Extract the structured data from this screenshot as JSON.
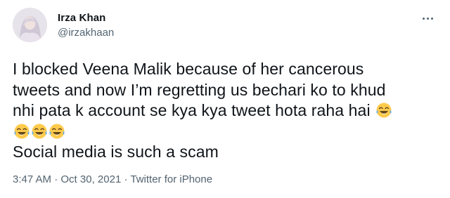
{
  "author": {
    "name": "Irza Khan",
    "handle": "@irzakhaan"
  },
  "tweet": {
    "lines": [
      "I blocked Veena Malik because of her cancerous",
      "tweets and now I’m regretting us bechari ko to khud",
      "nhi pata k account se kya kya tweet hota raha hai"
    ],
    "last_line": "Social media is such a scam",
    "emoji": "face-with-tears-of-joy-icon"
  },
  "meta": {
    "time": "3:47 AM",
    "separator": " · ",
    "date": "Oct 30, 2021",
    "source": "Twitter for iPhone"
  },
  "colors": {
    "text": "#0f1419",
    "secondary": "#536471",
    "background": "#ffffff",
    "emoji_face": "#ffcb4c",
    "emoji_tear": "#5dadec"
  }
}
